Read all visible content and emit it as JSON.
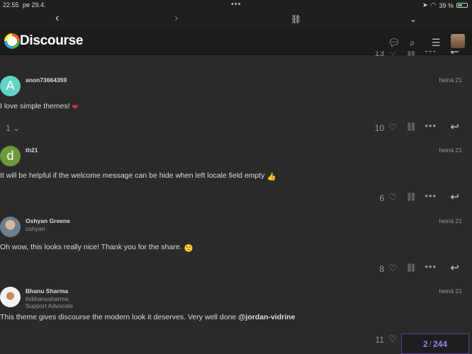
{
  "status": {
    "time": "22.55",
    "date": "pe 29.4.",
    "battery": "39 %"
  },
  "header": {
    "logo": "Discourse"
  },
  "top_partial": {
    "likes": "13"
  },
  "posts": [
    {
      "avatar_letter": "A",
      "avatar_color": "#5fd4c8",
      "username": "anon73664359",
      "login": "",
      "title": "",
      "date": "heinä 21",
      "text": "I love simple themes!",
      "emoji": "❤",
      "replies": "1",
      "likes": "10"
    },
    {
      "avatar_letter": "d",
      "avatar_color": "#6c9b3a",
      "username": "th21",
      "login": "",
      "title": "",
      "date": "heinä 21",
      "text": "It will be helpful if the welcome message can be hide when left locale field empty",
      "emoji": "👍",
      "replies": "",
      "likes": "6"
    },
    {
      "avatar_letter": "",
      "avatar_color": "#8a7a6a",
      "username": "Oshyan Greene",
      "login": "oshyan",
      "title": "",
      "date": "heinä 21",
      "text": "Oh wow, this looks really nice! Thank you for the share.",
      "emoji": "🙂",
      "replies": "",
      "likes": "8"
    },
    {
      "avatar_letter": "",
      "avatar_color": "#f4f4f4",
      "username": "Bhanu Sharma",
      "login": "itsbhanusharma",
      "title": "Support Advocate",
      "date": "heinä 21",
      "text": "This theme gives discourse the modern look it deserves. Very well done",
      "mention": "@jordan-vidrine",
      "emoji": "",
      "replies": "",
      "likes": "11"
    }
  ],
  "progress": {
    "current": "2",
    "total": "244"
  },
  "colors": {
    "background": "#2a2a2a",
    "header": "#1c1c1c",
    "progress_accent": "#9e7ef0"
  }
}
